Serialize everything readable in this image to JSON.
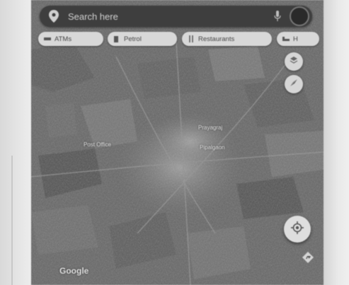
{
  "search": {
    "placeholder": "Search here"
  },
  "chips": [
    {
      "label": "ATMs",
      "icon": "atm-icon"
    },
    {
      "label": "Petrol",
      "icon": "fuel-pump-icon"
    },
    {
      "label": "Restaurants",
      "icon": "restaurant-icon"
    },
    {
      "label": "H",
      "icon": "hotel-bed-icon"
    }
  ],
  "map": {
    "labels": [
      {
        "text": "Prayagraj"
      },
      {
        "text": "Post Office"
      },
      {
        "text": "Pipalgaon"
      }
    ],
    "attribution": "Google",
    "layer_type": "satellite"
  },
  "buttons": {
    "layers_icon": "layers-icon",
    "compass_icon": "compass-icon",
    "my_location_icon": "my-location-icon",
    "navigate_icon": "navigate-arrow-icon"
  },
  "colors": {
    "screen_bg": "#5a5a5a",
    "chip_bg": "#d8d8d8",
    "search_bg": "#3e3e3e"
  }
}
